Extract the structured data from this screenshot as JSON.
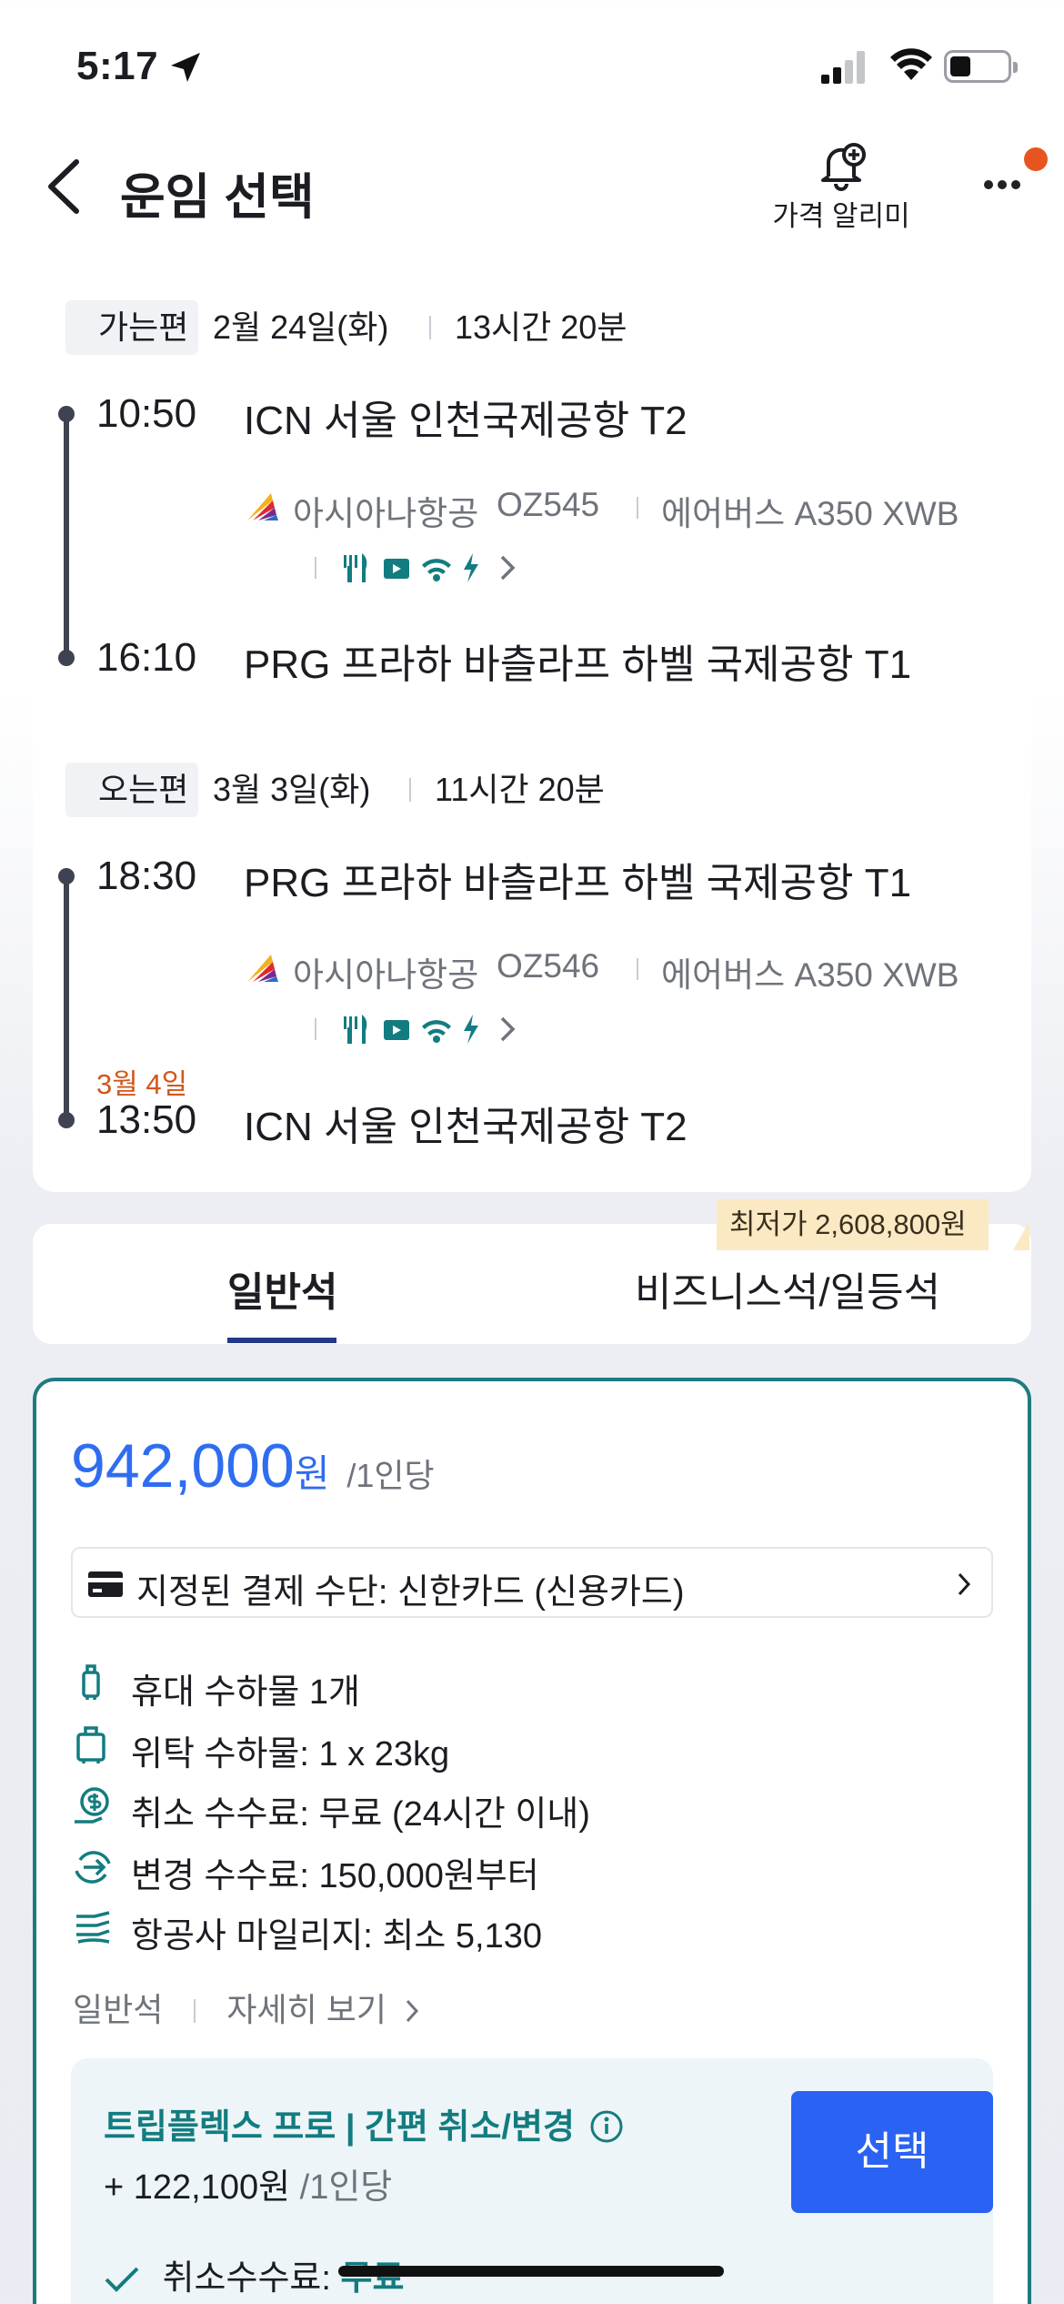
{
  "status_bar": {
    "time": "5:17"
  },
  "header": {
    "title": "운임 선택",
    "alert_label": "가격 알리미"
  },
  "outbound": {
    "tag": "가는편",
    "date": "2월 24일(화)",
    "duration": "13시간 20분",
    "dep_time": "10:50",
    "dep_airport": "ICN 서울 인천국제공항 T2",
    "airline": "아시아나항공",
    "flight_no": "OZ545",
    "aircraft": "에어버스 A350 XWB",
    "arr_time": "16:10",
    "arr_airport": "PRG 프라하 바츨라프 하벨 국제공항 T1"
  },
  "inbound": {
    "tag": "오는편",
    "date": "3월 3일(화)",
    "duration": "11시간 20분",
    "dep_time": "18:30",
    "dep_airport": "PRG 프라하 바츨라프 하벨 국제공항 T1",
    "airline": "아시아나항공",
    "flight_no": "OZ546",
    "aircraft": "에어버스 A350 XWB",
    "arr_note": "3월 4일",
    "arr_time": "13:50",
    "arr_airport": "ICN 서울 인천국제공항 T2"
  },
  "tabs": {
    "economy": "일반석",
    "business": "비즈니스석/일등석",
    "lowest_badge": "최저가 2,608,800원"
  },
  "fare": {
    "price": "942,000",
    "currency": "원",
    "per_person": "/1인당",
    "payment": "지정된 결제 수단: 신한카드 (신용카드)",
    "features": [
      "휴대 수하물 1개",
      "위탁 수하물: 1 x 23kg",
      "취소 수수료: 무료 (24시간 이내)",
      "변경 수수료: 150,000원부터",
      "항공사 마일리지: 최소 5,130"
    ],
    "class_name": "일반석",
    "details_link": "자세히 보기"
  },
  "flex": {
    "title": "트립플렉스 프로 | 간편 취소/변경",
    "price": "+ 122,100원",
    "per_person": "/1인당",
    "select_label": "선택",
    "cancel_label": "취소수수료:",
    "cancel_value": "무료"
  },
  "colors": {
    "accent_blue": "#2a62f4",
    "teal": "#137c80",
    "orange": "#d2561b"
  }
}
